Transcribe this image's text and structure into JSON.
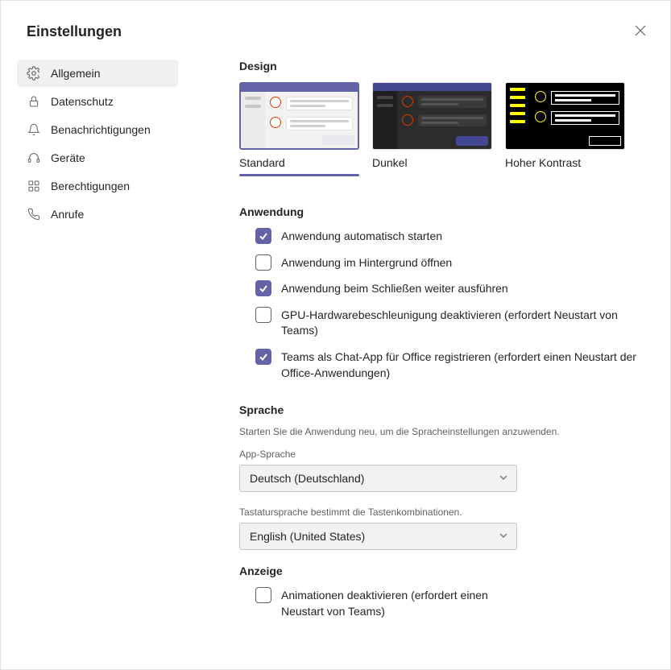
{
  "titlebar": {
    "title": "Einstellungen"
  },
  "sidebar": {
    "items": [
      {
        "label": "Allgemein"
      },
      {
        "label": "Datenschutz"
      },
      {
        "label": "Benachrichtigungen"
      },
      {
        "label": "Geräte"
      },
      {
        "label": "Berechtigungen"
      },
      {
        "label": "Anrufe"
      }
    ]
  },
  "design": {
    "heading": "Design",
    "themes": [
      {
        "label": "Standard"
      },
      {
        "label": "Dunkel"
      },
      {
        "label": "Hoher Kontrast"
      }
    ]
  },
  "application": {
    "heading": "Anwendung",
    "options": [
      {
        "label": "Anwendung automatisch starten",
        "checked": true
      },
      {
        "label": "Anwendung im Hintergrund öffnen",
        "checked": false
      },
      {
        "label": "Anwendung beim Schließen weiter ausführen",
        "checked": true
      },
      {
        "label": "GPU-Hardwarebeschleunigung deaktivieren (erfordert Neustart von Teams)",
        "checked": false
      },
      {
        "label": "Teams als Chat-App für Office registrieren (erfordert einen Neustart der Office-Anwendungen)",
        "checked": true
      }
    ]
  },
  "language": {
    "heading": "Sprache",
    "hint": "Starten Sie die Anwendung neu, um die Spracheinstellungen anzuwenden.",
    "app_label": "App-Sprache",
    "app_value": "Deutsch (Deutschland)",
    "keyboard_hint": "Tastatursprache bestimmt die Tastenkombinationen.",
    "keyboard_value": "English (United States)"
  },
  "display": {
    "heading": "Anzeige",
    "options": [
      {
        "label": "Animationen deaktivieren (erfordert einen Neustart von Teams)",
        "checked": false
      }
    ]
  }
}
